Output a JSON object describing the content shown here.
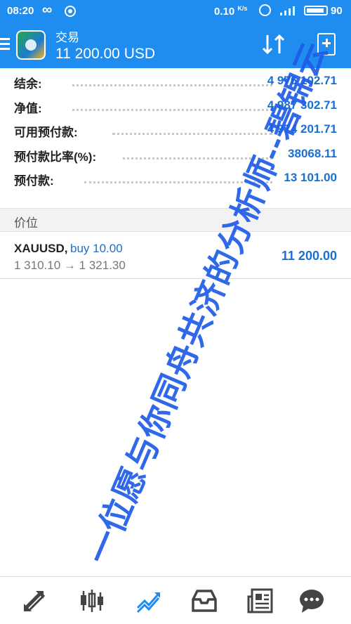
{
  "status_bar": {
    "time": "08:20",
    "speed": "0.10",
    "speed_unit": "K/s",
    "battery_level": "90"
  },
  "header": {
    "title": "交易",
    "subtitle": "11 200.00 USD"
  },
  "account": [
    {
      "label": "结余:",
      "value": "4 976 102.71"
    },
    {
      "label": "净值:",
      "value": "4 987 302.71"
    },
    {
      "label": "可用预付款:",
      "value": "4 974 201.71"
    },
    {
      "label": "预付款比率(%):",
      "value": "38068.11"
    },
    {
      "label": "预付款:",
      "value": "13 101.00"
    }
  ],
  "section_title": "价位",
  "position": {
    "symbol": "XAUUSD,",
    "side": "buy 10.00",
    "prices": "1 310.10 → 1 321.30",
    "profit": "11 200.00"
  },
  "watermark": "一位愿与你同舟共济的分析师--碧锦云",
  "colors": {
    "header_bg": "#1f8cf0",
    "value_blue": "#1a6fd1",
    "watermark_blue": "#1e5ce8",
    "active_nav": "#1f8cf0",
    "inactive_nav": "#444444"
  },
  "nav": [
    {
      "icon": "quotes-icon",
      "active": false
    },
    {
      "icon": "chart-icon",
      "active": false
    },
    {
      "icon": "trade-icon",
      "active": true
    },
    {
      "icon": "history-icon",
      "active": false
    },
    {
      "icon": "news-icon",
      "active": false
    },
    {
      "icon": "chat-icon",
      "active": false
    }
  ]
}
